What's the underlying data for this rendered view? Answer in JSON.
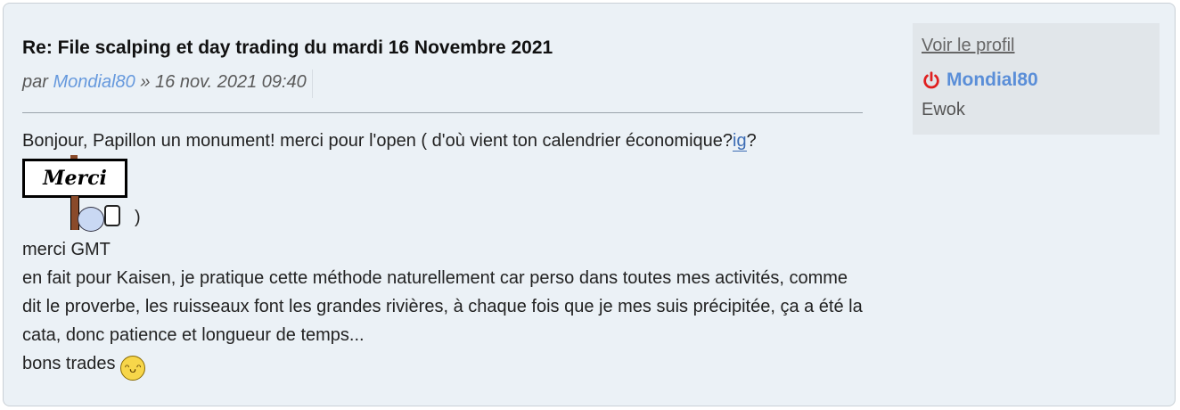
{
  "post": {
    "title": "Re: File scalping et day trading du mardi 16 Novembre 2021",
    "by_prefix": "par",
    "author": "Mondial80",
    "date_sep": "»",
    "date": "16 nov. 2021 09:40",
    "body": {
      "line1_text": "Bonjour, Papillon un monument! merci pour l'open ( d'où vient ton calendrier économique?",
      "line1_link": "ig",
      "line1_end": "?",
      "merci_sign_text": "Merci",
      "paren_close": ")",
      "line_gmt": "merci GMT",
      "paragraph": "en fait pour Kaisen, je pratique cette méthode naturellement car perso dans toutes mes activités, comme dit le proverbe, les ruisseaux font les grandes rivières, à chaque fois que je mes suis précipitée, ça a été la cata, donc patience et longueur de temps...",
      "closing": "bons trades",
      "closing_emoji": "grinning-emoji"
    }
  },
  "profile": {
    "view_profile": "Voir le profil",
    "username": "Mondial80",
    "status_icon": "power-icon",
    "status_color": "#e02020",
    "rank": "Ewok"
  }
}
